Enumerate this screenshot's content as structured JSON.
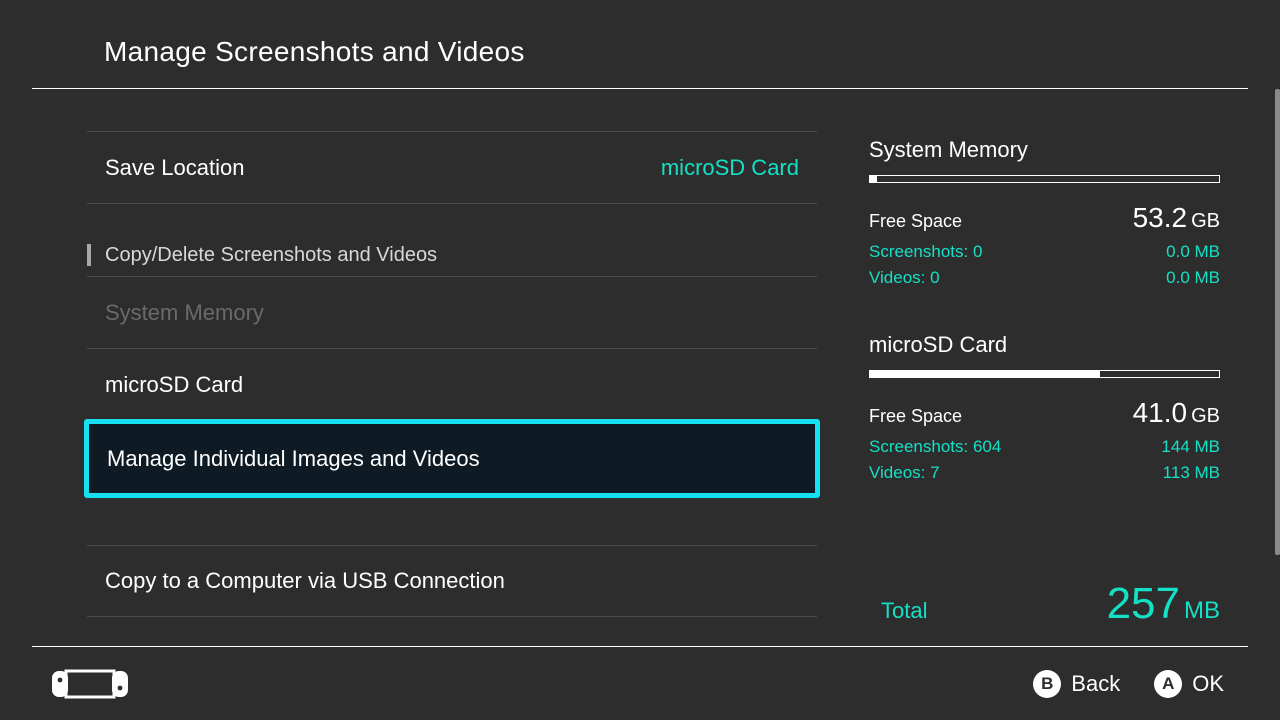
{
  "header": {
    "title": "Manage Screenshots and Videos"
  },
  "left": {
    "save_location_label": "Save Location",
    "save_location_value": "microSD Card",
    "section_label": "Copy/Delete Screenshots and Videos",
    "system_memory": "System Memory",
    "microsd": "microSD Card",
    "manage_individual": "Manage Individual Images and Videos",
    "copy_usb": "Copy to a Computer via USB Connection"
  },
  "right": {
    "sysmem": {
      "title": "System Memory",
      "fill_pct": 2,
      "free_label": "Free Space",
      "free_value": "53.2",
      "free_unit": "GB",
      "screenshots_label": "Screenshots: 0",
      "screenshots_value": "0.0 MB",
      "videos_label": "Videos: 0",
      "videos_value": "0.0 MB"
    },
    "sd": {
      "title": "microSD Card",
      "fill_pct": 66,
      "free_label": "Free Space",
      "free_value": "41.0",
      "free_unit": "GB",
      "screenshots_label": "Screenshots: 604",
      "screenshots_value": "144 MB",
      "videos_label": "Videos: 7",
      "videos_value": "113 MB"
    },
    "total": {
      "label": "Total",
      "value": "257",
      "unit": "MB"
    }
  },
  "footer": {
    "back_glyph": "B",
    "back_label": "Back",
    "ok_glyph": "A",
    "ok_label": "OK"
  }
}
